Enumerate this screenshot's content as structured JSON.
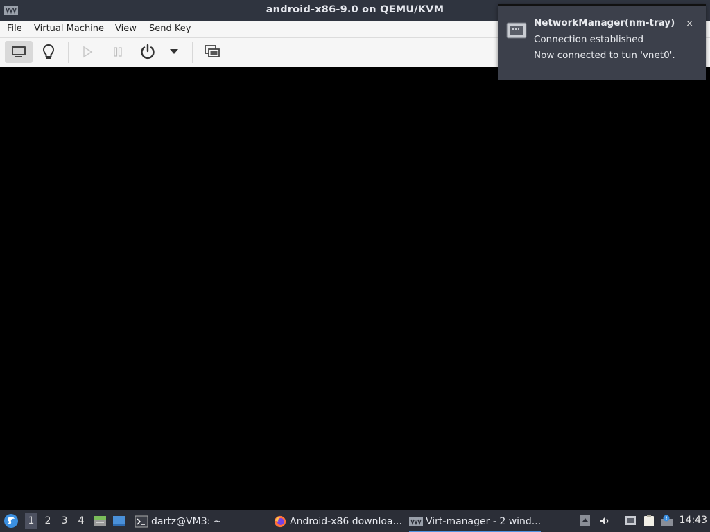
{
  "window": {
    "title": "android-x86-9.0 on QEMU/KVM",
    "app_icon": "virt-manager-icon"
  },
  "menubar": {
    "items": [
      "File",
      "Virtual Machine",
      "View",
      "Send Key"
    ]
  },
  "toolbar": {
    "buttons": [
      {
        "name": "console-display",
        "icon": "monitor-icon",
        "active": true
      },
      {
        "name": "details",
        "icon": "lightbulb-icon",
        "active": false
      },
      {
        "name": "run",
        "icon": "play-icon",
        "enabled": false
      },
      {
        "name": "pause",
        "icon": "pause-icon",
        "enabled": false
      },
      {
        "name": "shutdown",
        "icon": "power-icon",
        "enabled": true
      },
      {
        "name": "shutdown-menu",
        "icon": "chevron-down-icon",
        "enabled": true
      },
      {
        "name": "snapshots",
        "icon": "screens-icon",
        "enabled": true
      }
    ]
  },
  "notification": {
    "title": "NetworkManager(nm-tray)",
    "line1": "Connection established",
    "line2": "Now connected to tun 'vnet0'.",
    "close_glyph": "×"
  },
  "taskbar": {
    "workspaces": [
      "1",
      "2",
      "3",
      "4"
    ],
    "active_workspace": "1",
    "tasks": [
      {
        "label": "dartz@VM3: ~",
        "icon": "terminal-icon"
      },
      {
        "label": "Android-x86 downloa...",
        "icon": "firefox-icon"
      },
      {
        "label": "Virt-manager - 2 wind...",
        "icon": "virt-manager-icon",
        "active": true
      }
    ],
    "clock": "14:43"
  },
  "colors": {
    "titlebar": "#2f343f",
    "taskbar": "#2b2e37",
    "accent": "#5294e2",
    "notification_bg": "#3c404b"
  }
}
